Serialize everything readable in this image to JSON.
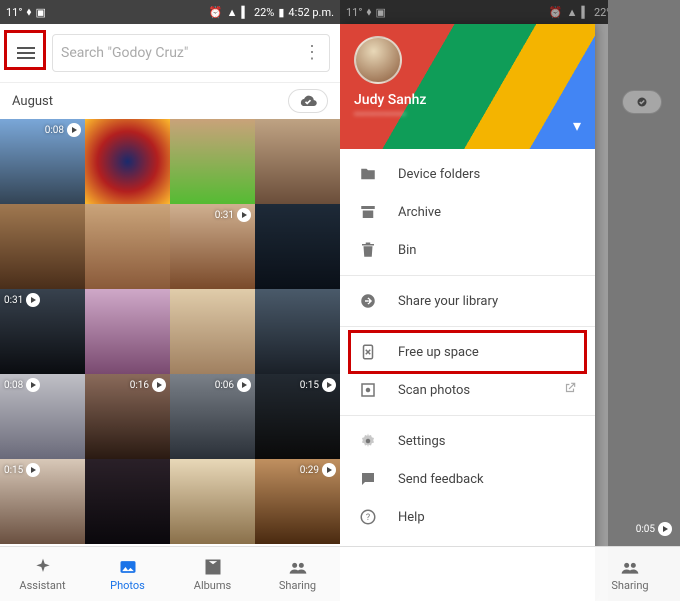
{
  "status": {
    "temperature": "11°",
    "battery_pct": "22%",
    "time": "4:52 p.m."
  },
  "left": {
    "search_placeholder": "Search \"Godoy Cruz\"",
    "section_label": "August",
    "thumbs": [
      {
        "dur": "0:08",
        "play": true
      },
      {
        "dur": "",
        "play": false
      },
      {
        "dur": "",
        "play": false
      },
      {
        "dur": "",
        "play": false
      },
      {
        "dur": "",
        "play": false
      },
      {
        "dur": "",
        "play": false
      },
      {
        "dur": "0:31",
        "play": true,
        "pos": "right"
      },
      {
        "dur": "",
        "play": false
      },
      {
        "dur": "0:31",
        "play": true,
        "pos": "left"
      },
      {
        "dur": "",
        "play": false
      },
      {
        "dur": "",
        "play": false
      },
      {
        "dur": "",
        "play": false
      },
      {
        "dur": "0:08",
        "play": true,
        "pos": "left"
      },
      {
        "dur": "0:16",
        "play": true
      },
      {
        "dur": "0:06",
        "play": true
      },
      {
        "dur": "0:15",
        "play": true
      },
      {
        "dur": "0:15",
        "play": true,
        "pos": "left"
      },
      {
        "dur": "",
        "play": false
      },
      {
        "dur": "",
        "play": false
      },
      {
        "dur": "0:29",
        "play": true
      }
    ],
    "nav": {
      "assistant": "Assistant",
      "photos": "Photos",
      "albums": "Albums",
      "sharing": "Sharing",
      "active": "photos"
    }
  },
  "right": {
    "user_name": "Judy Sanhz",
    "menu": {
      "device_folders": "Device folders",
      "archive": "Archive",
      "bin": "Bin",
      "share_library": "Share your library",
      "free_up_space": "Free up space",
      "scan_photos": "Scan photos",
      "settings": "Settings",
      "send_feedback": "Send feedback",
      "help": "Help"
    },
    "peek_dur": "0:05",
    "nav_sharing": "Sharing"
  }
}
